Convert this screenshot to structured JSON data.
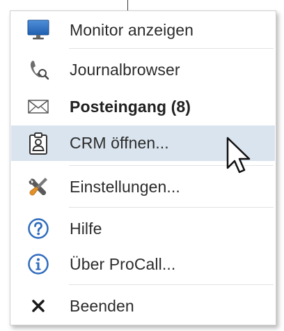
{
  "menu": {
    "items": [
      {
        "label": "Monitor anzeigen",
        "icon": "monitor-icon",
        "bold": false,
        "highlighted": false
      },
      {
        "label": "Journalbrowser",
        "icon": "phone-search-icon",
        "bold": false,
        "highlighted": false
      },
      {
        "label": "Posteingang (8)",
        "icon": "envelope-icon",
        "bold": true,
        "highlighted": false
      },
      {
        "label": "CRM öffnen...",
        "icon": "contact-card-icon",
        "bold": false,
        "highlighted": true
      },
      {
        "label": "Einstellungen...",
        "icon": "tools-icon",
        "bold": false,
        "highlighted": false
      },
      {
        "label": "Hilfe",
        "icon": "help-icon",
        "bold": false,
        "highlighted": false
      },
      {
        "label": "Über ProCall...",
        "icon": "info-icon",
        "bold": false,
        "highlighted": false
      },
      {
        "label": "Beenden",
        "icon": "close-icon",
        "bold": false,
        "highlighted": false
      }
    ]
  },
  "colors": {
    "highlight": "#d9e4ee",
    "accent_blue": "#2f6bbd",
    "text": "#2b2b2b"
  }
}
